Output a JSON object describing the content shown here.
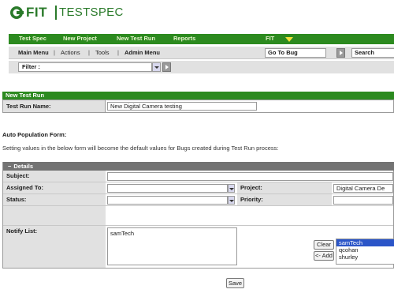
{
  "logo": {
    "part1": "FIT",
    "part2": "TESTSPEC"
  },
  "topnav": {
    "items": [
      "Test Spec",
      "New Project",
      "New Test Run",
      "Reports",
      "FIT"
    ]
  },
  "subnav": {
    "items": [
      "Main Menu",
      "Actions",
      "Tools",
      "Admin Menu"
    ],
    "separator": "|",
    "goto_value": "Go To Bug",
    "search_value": "Search"
  },
  "filter": {
    "selected": "Filter :"
  },
  "new_test_run": {
    "header": "New Test Run",
    "name_label": "Test Run Name:",
    "name_value": "New Digital Camera testing"
  },
  "auto_population": {
    "title": "Auto Population Form:",
    "description": "Setting values in the below form will become the default values for Bugs created during Test Run process:"
  },
  "details": {
    "collapse_symbol": "−",
    "header": "Details",
    "subject_label": "Subject:",
    "subject_value": "",
    "assigned_label": "Assigned To:",
    "assigned_value": "",
    "project_label": "Project:",
    "project_value": "Digital Camera De",
    "status_label": "Status:",
    "status_value": "",
    "priority_label": "Priority:",
    "priority_value": "",
    "notify_label": "Notify List:",
    "notify_value": "samTech",
    "clear_label": "Clear",
    "add_label": "<- Add",
    "users": [
      {
        "name": "samTech",
        "selected": true
      },
      {
        "name": "qcohan",
        "selected": false
      },
      {
        "name": "shurley",
        "selected": false
      }
    ]
  },
  "save_label": "Save",
  "colors": {
    "brand_green": "#2c8a1f",
    "logo_green": "#2a7a2a",
    "details_header": "#737373",
    "selection_blue": "#2b55c8"
  }
}
